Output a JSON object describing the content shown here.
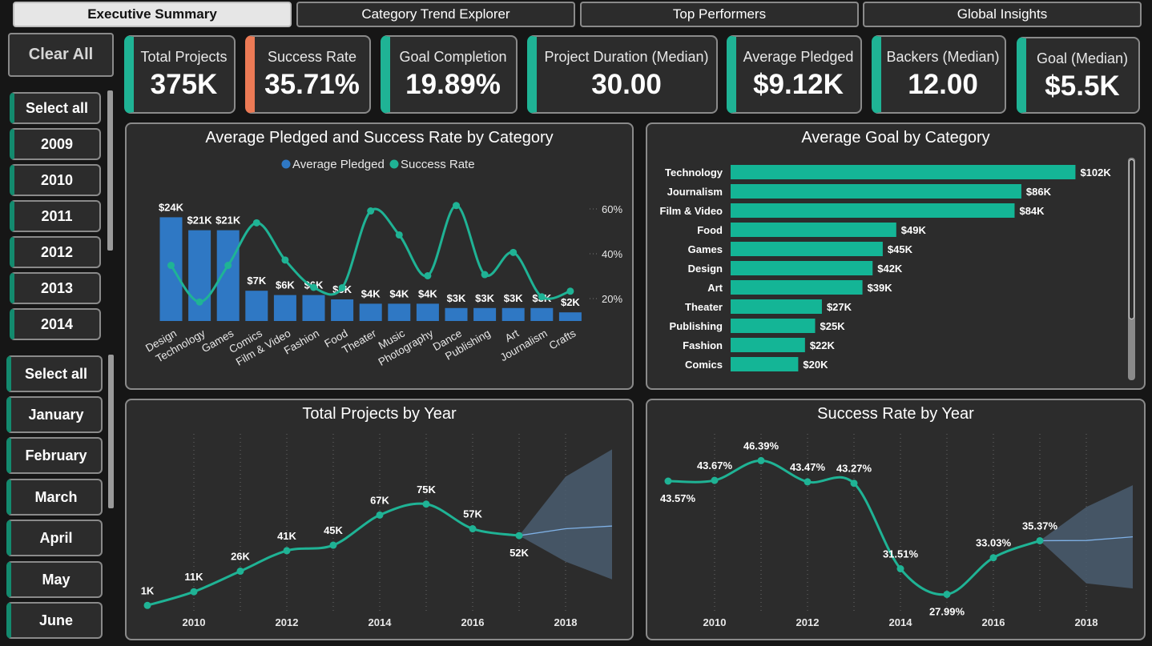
{
  "tabs": [
    "Executive Summary",
    "Category Trend Explorer",
    "Top Performers",
    "Global Insights"
  ],
  "clear_all": "Clear All",
  "year_slicer": [
    "Select all",
    "2009",
    "2010",
    "2011",
    "2012",
    "2013",
    "2014"
  ],
  "month_slicer": [
    "Select all",
    "January",
    "February",
    "March",
    "April",
    "May",
    "June"
  ],
  "kpis": [
    {
      "label": "Total Projects",
      "value": "375K"
    },
    {
      "label": "Success Rate",
      "value": "35.71%"
    },
    {
      "label": "Goal Completion",
      "value": "19.89%"
    },
    {
      "label": "Project Duration (Median)",
      "value": "30.00"
    },
    {
      "label": "Average Pledged",
      "value": "$9.12K"
    },
    {
      "label": "Backers (Median)",
      "value": "12.00"
    },
    {
      "label": "Goal (Median)",
      "value": "$5.5K"
    }
  ],
  "colors": {
    "accent": "#1fb395",
    "warning": "#ec7a55",
    "bar_blue": "#2f78c4",
    "line_green": "#1fb395",
    "goal_bar": "#14b596",
    "forecast": "#4a5d70"
  },
  "chart_data": [
    {
      "type": "bar",
      "title": "Average Pledged and Success Rate by Category",
      "legend": [
        "Average Pledged",
        "Success Rate"
      ],
      "legend_position": "top-center",
      "categories": [
        "Design",
        "Technology",
        "Games",
        "Comics",
        "Film & Video",
        "Fashion",
        "Food",
        "Theater",
        "Music",
        "Photography",
        "Dance",
        "Publishing",
        "Art",
        "Journalism",
        "Crafts"
      ],
      "series": [
        {
          "name": "Average Pledged",
          "type": "bar",
          "values": [
            24,
            21,
            21,
            7,
            6,
            6,
            5,
            4,
            4,
            4,
            3,
            3,
            3,
            3,
            2
          ],
          "labels": [
            "$24K",
            "$21K",
            "$21K",
            "$7K",
            "$6K",
            "$6K",
            "$5K",
            "$4K",
            "$4K",
            "$4K",
            "$3K",
            "$3K",
            "$3K",
            "$3K",
            "$2K"
          ]
        },
        {
          "name": "Success Rate",
          "type": "line",
          "values": [
            34.8,
            18.5,
            34.8,
            53.8,
            37.2,
            25.0,
            24.8,
            59.1,
            48.4,
            30.2,
            61.5,
            30.7,
            40.6,
            20.8,
            23.3
          ]
        }
      ],
      "y2_ticks": [
        "20%",
        "40%",
        "60%"
      ],
      "y2_range": [
        10,
        70
      ]
    },
    {
      "type": "bar",
      "orientation": "horizontal",
      "title": "Average Goal by Category",
      "categories": [
        "Technology",
        "Journalism",
        "Film & Video",
        "Food",
        "Games",
        "Design",
        "Art",
        "Theater",
        "Publishing",
        "Fashion",
        "Comics"
      ],
      "values": [
        102,
        86,
        84,
        49,
        45,
        42,
        39,
        27,
        25,
        22,
        20
      ],
      "labels": [
        "$102K",
        "$86K",
        "$84K",
        "$49K",
        "$45K",
        "$42K",
        "$39K",
        "$27K",
        "$25K",
        "$22K",
        "$20K"
      ]
    },
    {
      "type": "line",
      "title": "Total Projects by Year",
      "x": [
        2009,
        2010,
        2011,
        2012,
        2013,
        2014,
        2015,
        2016,
        2017
      ],
      "values": [
        1,
        11,
        26,
        41,
        45,
        67,
        75,
        57,
        52
      ],
      "labels": [
        "1K",
        "11K",
        "26K",
        "41K",
        "45K",
        "67K",
        "75K",
        "57K",
        "52K"
      ],
      "x_ticks": [
        "2010",
        "2012",
        "2014",
        "2016",
        "2018"
      ],
      "forecast": {
        "x": [
          2017,
          2018,
          2019
        ],
        "mid": [
          52,
          57,
          59
        ],
        "upper": [
          52,
          95,
          115
        ],
        "lower": [
          52,
          33,
          20
        ]
      }
    },
    {
      "type": "line",
      "title": "Success Rate by Year",
      "x": [
        2009,
        2010,
        2011,
        2012,
        2013,
        2014,
        2015,
        2016,
        2017
      ],
      "values": [
        43.57,
        43.67,
        46.39,
        43.47,
        43.27,
        31.51,
        27.99,
        33.03,
        35.37
      ],
      "labels": [
        "43.57%",
        "43.67%",
        "46.39%",
        "43.47%",
        "43.27%",
        "31.51%",
        "27.99%",
        "33.03%",
        "35.37%"
      ],
      "x_ticks": [
        "2010",
        "2012",
        "2014",
        "2016",
        "2018"
      ],
      "forecast": {
        "x": [
          2017,
          2018,
          2019
        ],
        "mid": [
          35.37,
          35.4,
          35.9
        ],
        "upper": [
          35.37,
          40.0,
          43.0
        ],
        "lower": [
          35.37,
          29.5,
          28.8
        ]
      }
    }
  ]
}
